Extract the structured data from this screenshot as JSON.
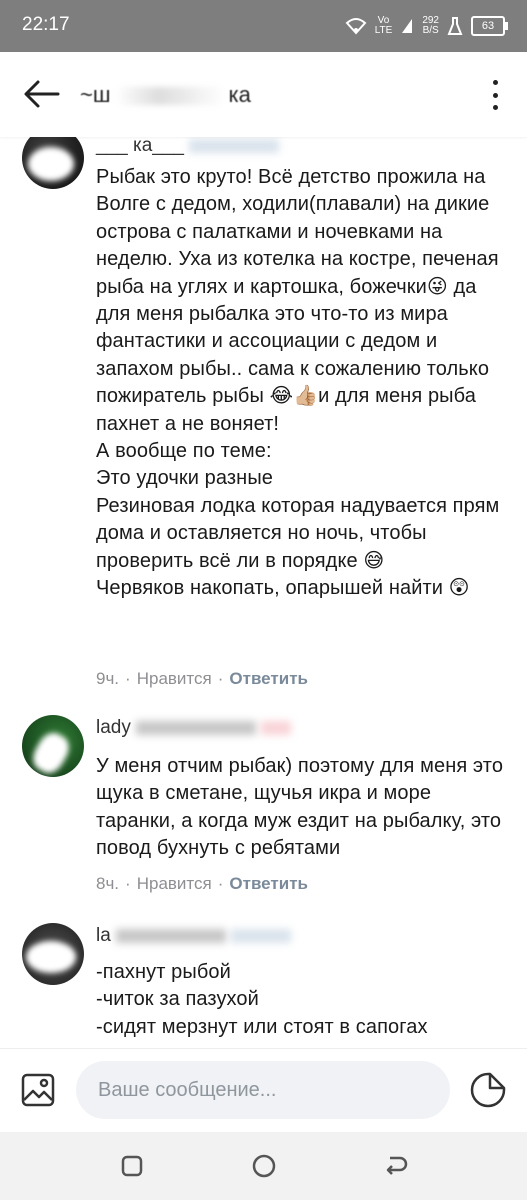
{
  "status_bar": {
    "time": "22:17",
    "lte_top": "Vo",
    "lte_bottom": "LTE",
    "speed_top": "292",
    "speed_bottom": "B/S",
    "battery": "63"
  },
  "header": {
    "title_start": "~ш",
    "title_end": "ка"
  },
  "comments": [
    {
      "author_start": "___ ка___",
      "text": "Рыбак это круто! Всё детство прожила на Волге с дедом, ходили(плавали) на дикие острова с палатками и ночевками на неделю. Уха из котелка на костре, печеная рыба на углях и картошка, божечки😜 да для меня рыбалка это что-то из мира фантастики и ассоциации с дедом и запахом рыбы.. сама к сожалению только пожиратель рыбы 😂👍🏼и для меня рыба пахнет а не воняет!\nА вообще по теме:\nЭто удочки разные\nРезиновая лодка которая надувается прям дома и оставляется но ночь, чтобы проверить всё ли в порядке 😅\nЧервяков накопать, опарышей найти 😲",
      "time": "9ч.",
      "like": "Нравится",
      "reply": "Ответить"
    },
    {
      "author_start": "lady",
      "text": "У меня отчим рыбак) поэтому для меня это щука в сметане, щучья икра и море таранки, а когда муж ездит на рыбалку, это повод бухнуть с ребятами",
      "time": "8ч.",
      "like": "Нравится",
      "reply": "Ответить"
    },
    {
      "author_start": "la",
      "text": "-пахнут рыбой\n-читок за пазухой\n-сидят мерзнут или стоят в сапогах",
      "time": "",
      "like": "",
      "reply": ""
    }
  ],
  "composer": {
    "placeholder": "Ваше сообщение..."
  },
  "colors": {
    "status_bar": "#7e7e7e",
    "nav_bar": "#f2f2f2",
    "input_bg": "#f0f2f5",
    "meta_text": "#8e8e93"
  }
}
